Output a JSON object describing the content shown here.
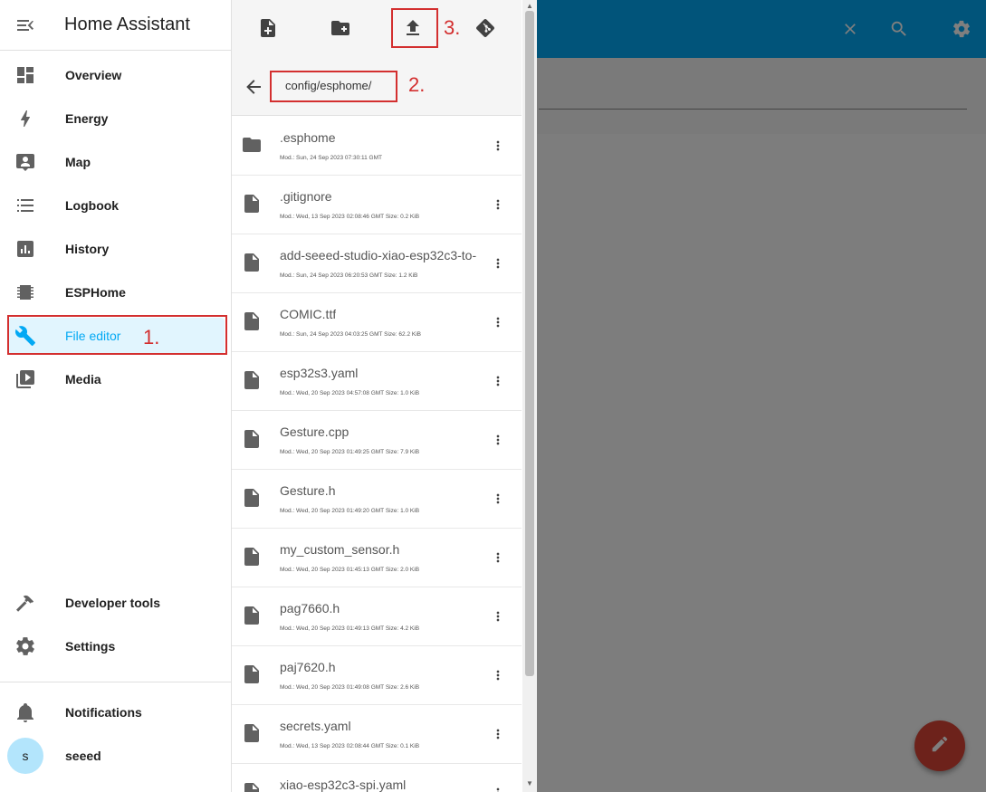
{
  "app": {
    "title": "Home Assistant"
  },
  "sidebar": {
    "items": [
      {
        "label": "Overview",
        "icon": "dashboard-icon"
      },
      {
        "label": "Energy",
        "icon": "lightning-icon"
      },
      {
        "label": "Map",
        "icon": "map-account-icon"
      },
      {
        "label": "Logbook",
        "icon": "list-icon"
      },
      {
        "label": "History",
        "icon": "chart-box-icon"
      },
      {
        "label": "ESPHome",
        "icon": "chip-icon"
      },
      {
        "label": "File editor",
        "icon": "wrench-icon",
        "selected": true
      },
      {
        "label": "Media",
        "icon": "play-box-multiple-icon"
      }
    ],
    "developer_tools": "Developer tools",
    "settings": "Settings",
    "notifications": "Notifications",
    "user": {
      "name": "seeed",
      "initial": "s"
    }
  },
  "file_panel": {
    "path": "config/esphome/",
    "files": [
      {
        "name": ".esphome",
        "meta": "Mod.: Sun, 24 Sep 2023 07:30:11 GMT",
        "icon": "folder-icon"
      },
      {
        "name": ".gitignore",
        "meta": "Mod.: Wed, 13 Sep 2023 02:08:46 GMT  Size: 0.2 KiB",
        "icon": "file-icon"
      },
      {
        "name": "add-seeed-studio-xiao-esp32c3-to-",
        "meta": "Mod.: Sun, 24 Sep 2023 06:20:53 GMT  Size: 1.2 KiB",
        "icon": "file-code-icon"
      },
      {
        "name": "COMIC.ttf",
        "meta": "Mod.: Sun, 24 Sep 2023 04:03:25 GMT  Size: 62.2 KiB",
        "icon": "file-icon"
      },
      {
        "name": "esp32s3.yaml",
        "meta": "Mod.: Wed, 20 Sep 2023 04:57:08 GMT  Size: 1.0 KiB",
        "icon": "file-code-icon"
      },
      {
        "name": "Gesture.cpp",
        "meta": "Mod.: Wed, 20 Sep 2023 01:49:25 GMT  Size: 7.9 KiB",
        "icon": "file-icon"
      },
      {
        "name": "Gesture.h",
        "meta": "Mod.: Wed, 20 Sep 2023 01:49:20 GMT  Size: 1.0 KiB",
        "icon": "file-icon"
      },
      {
        "name": "my_custom_sensor.h",
        "meta": "Mod.: Wed, 20 Sep 2023 01:45:13 GMT  Size: 2.0 KiB",
        "icon": "file-icon"
      },
      {
        "name": "pag7660.h",
        "meta": "Mod.: Wed, 20 Sep 2023 01:49:13 GMT  Size: 4.2 KiB",
        "icon": "file-icon"
      },
      {
        "name": "paj7620.h",
        "meta": "Mod.: Wed, 20 Sep 2023 01:49:08 GMT  Size: 2.6 KiB",
        "icon": "file-icon"
      },
      {
        "name": "secrets.yaml",
        "meta": "Mod.: Wed, 13 Sep 2023 02:08:44 GMT  Size: 0.1 KiB",
        "icon": "file-code-icon"
      },
      {
        "name": "xiao-esp32c3-spi.yaml",
        "meta": "",
        "icon": "file-code-icon"
      }
    ]
  },
  "annotations": {
    "one": "1.",
    "two": "2.",
    "three": "3."
  },
  "colors": {
    "accent": "#03a9f4",
    "annotation": "#d32f2f",
    "fab": "#db4437"
  }
}
